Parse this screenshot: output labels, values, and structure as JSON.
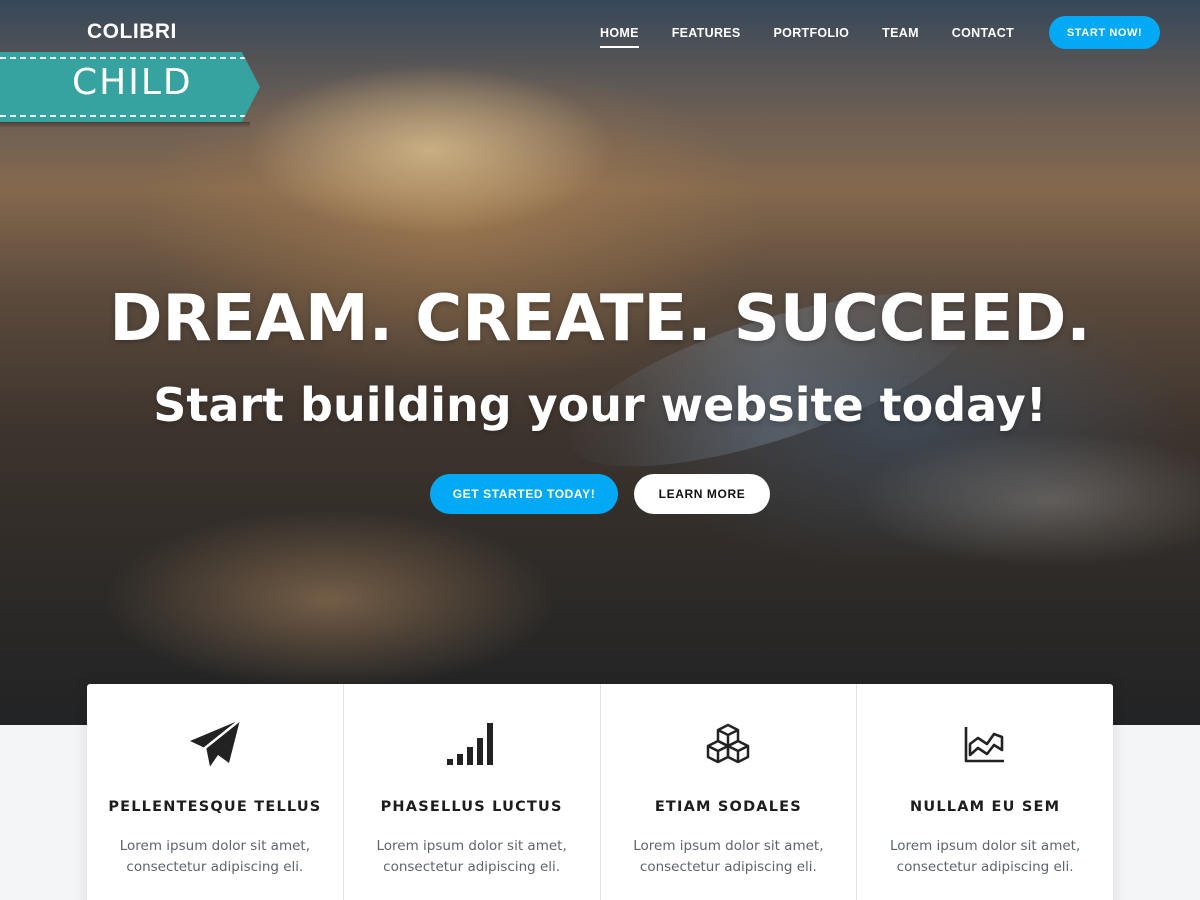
{
  "brand": {
    "logo": "COLIBRI",
    "ribbon": "CHILD"
  },
  "nav": {
    "items": [
      {
        "label": "HOME",
        "active": true
      },
      {
        "label": "FEATURES",
        "active": false
      },
      {
        "label": "PORTFOLIO",
        "active": false
      },
      {
        "label": "TEAM",
        "active": false
      },
      {
        "label": "CONTACT",
        "active": false
      }
    ],
    "cta": "START NOW!"
  },
  "hero": {
    "title": "DREAM. CREATE. SUCCEED.",
    "subtitle": "Start building your website today!",
    "primary_button": "GET STARTED TODAY!",
    "secondary_button": "LEARN MORE"
  },
  "features": [
    {
      "icon": "paper-plane-icon",
      "title": "PELLENTESQUE TELLUS",
      "line1": "Lorem ipsum dolor sit amet,",
      "line2": "consectetur adipiscing eli."
    },
    {
      "icon": "signal-bars-icon",
      "title": "PHASELLUS LUCTUS",
      "line1": "Lorem ipsum dolor sit amet,",
      "line2": "consectetur adipiscing eli."
    },
    {
      "icon": "cubes-icon",
      "title": "ETIAM SODALES",
      "line1": "Lorem ipsum dolor sit amet,",
      "line2": "consectetur adipiscing eli."
    },
    {
      "icon": "area-chart-icon",
      "title": "NULLAM EU SEM",
      "line1": "Lorem ipsum dolor sit amet,",
      "line2": "consectetur adipiscing eli."
    }
  ],
  "colors": {
    "accent": "#03a9f4",
    "ribbon": "#36a3a0",
    "text_dark": "#1d1d1d",
    "text_muted": "#5d6470"
  }
}
